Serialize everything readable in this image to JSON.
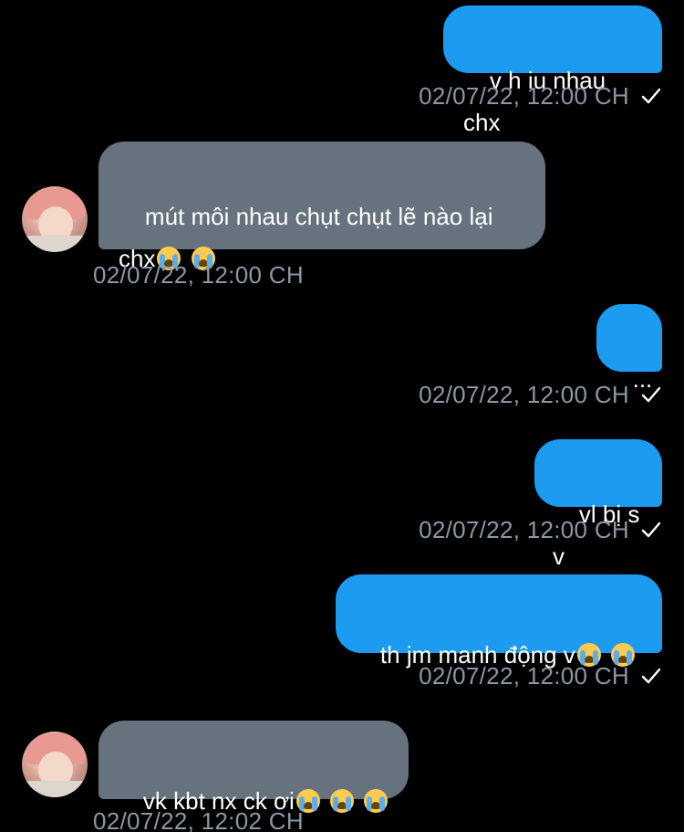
{
  "messages": [
    {
      "text": "v h iu nhau chx",
      "time": "02/07/22, 12:00 CH"
    },
    {
      "text": "mút môi nhau chụt chụt lẽ nào lại\nchx",
      "time": "02/07/22, 12:00 CH",
      "emoji": [
        "loudly-crying-face",
        "loudly-crying-face"
      ]
    },
    {
      "text": "...",
      "time": "02/07/22, 12:00 CH"
    },
    {
      "text": "vl bị s v",
      "time": "02/07/22, 12:00 CH"
    },
    {
      "text": "th jm manh động v",
      "time": "02/07/22, 12:00 CH",
      "emoji": [
        "loudly-crying-face",
        "loudly-crying-face"
      ]
    },
    {
      "text": "vk kbt nx ck ơi",
      "time": "02/07/22, 12:02 CH",
      "emoji": [
        "loudly-crying-face",
        "loudly-crying-face",
        "loudly-crying-face"
      ]
    }
  ],
  "colors": {
    "background": "#000000",
    "sent_bubble": "#1d9bf0",
    "received_bubble": "#66737f",
    "timestamp": "#8b98a5"
  }
}
